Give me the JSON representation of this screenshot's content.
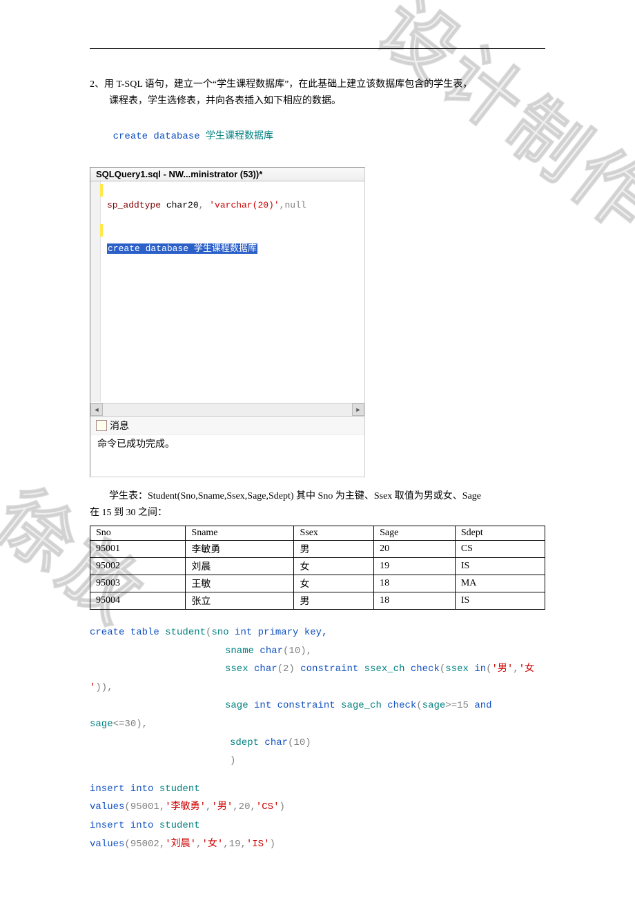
{
  "watermark": {
    "part1": "徐放",
    "part2": "设计制作"
  },
  "intro": {
    "line1": "2、用 T-SQL 语句，建立一个“学生课程数据库”，在此基础上建立该数据库包含的学生表，",
    "line2": "课程表，学生选修表，并向各表插入如下相应的数据。"
  },
  "create_db": {
    "kw": "create database",
    "name": "学生课程数据库"
  },
  "sql_window": {
    "title": "SQLQuery1.sql - NW...ministrator (53))*",
    "line1_sp": "sp_addtype",
    "line1_arg1": " char20",
    "line1_comma": ", ",
    "line1_str": "'varchar(20)'",
    "line1_comma2": ",",
    "line1_null": "null",
    "sel_kw": "create database ",
    "sel_name": "学生课程数据库",
    "msg_tab": "消息",
    "msg_body": "命令已成功完成。"
  },
  "student_desc": {
    "line1": "学生表：Student(Sno,Sname,Ssex,Sage,Sdept) 其中 Sno 为主键、Ssex 取值为男或女、Sage",
    "line2": "在 15 到 30 之间："
  },
  "student_table": {
    "headers": [
      "Sno",
      "Sname",
      "Ssex",
      "Sage",
      "Sdept"
    ],
    "rows": [
      [
        "95001",
        "李敏勇",
        "男",
        "20",
        "CS"
      ],
      [
        "95002",
        "刘晨",
        "女",
        "19",
        "IS"
      ],
      [
        "95003",
        "王敏",
        "女",
        "18",
        "MA"
      ],
      [
        "95004",
        "张立",
        "男",
        "18",
        "IS"
      ]
    ]
  },
  "create_student": {
    "l1": {
      "a": "create table ",
      "b": "student",
      "c": "(",
      "d": "sno ",
      "e": "int primary key,"
    },
    "l2": {
      "a": "sname ",
      "b": "char",
      "c": "(10),"
    },
    "l3": {
      "a": "ssex ",
      "b": "char",
      "c": "(2) ",
      "d": "constraint ",
      "e": "ssex_ch ",
      "f": "check",
      "g": "(",
      "h": "ssex ",
      "i": "in",
      "j": "(",
      "m": "'男'",
      "k": ",",
      "n": "'女"
    },
    "l3b": {
      "a": "'",
      "b": ")),"
    },
    "l4": {
      "a": "sage ",
      "b": "int constraint ",
      "c": "sage_ch ",
      "d": "check",
      "e": "(",
      "f": "sage",
      "g": ">=15 ",
      "h": "and"
    },
    "l4b": {
      "a": "sage",
      "b": "<=30),"
    },
    "l5": {
      "a": "sdept ",
      "b": "char",
      "c": "(10)"
    },
    "l6": {
      "a": ")"
    }
  },
  "inserts": {
    "i1a": "insert into ",
    "i1b": "student",
    "v1a": "values",
    "v1b": "(95001,",
    "v1c": "'李敏勇'",
    "v1d": ",",
    "v1e": "'男'",
    "v1f": ",20,",
    "v1g": "'CS'",
    "v1h": ")",
    "i2a": "insert into ",
    "i2b": "student",
    "v2a": "values",
    "v2b": "(95002,",
    "v2c": "'刘晨'",
    "v2d": ",",
    "v2e": "'女'",
    "v2f": ",19,",
    "v2g": "'IS'",
    "v2h": ")"
  }
}
